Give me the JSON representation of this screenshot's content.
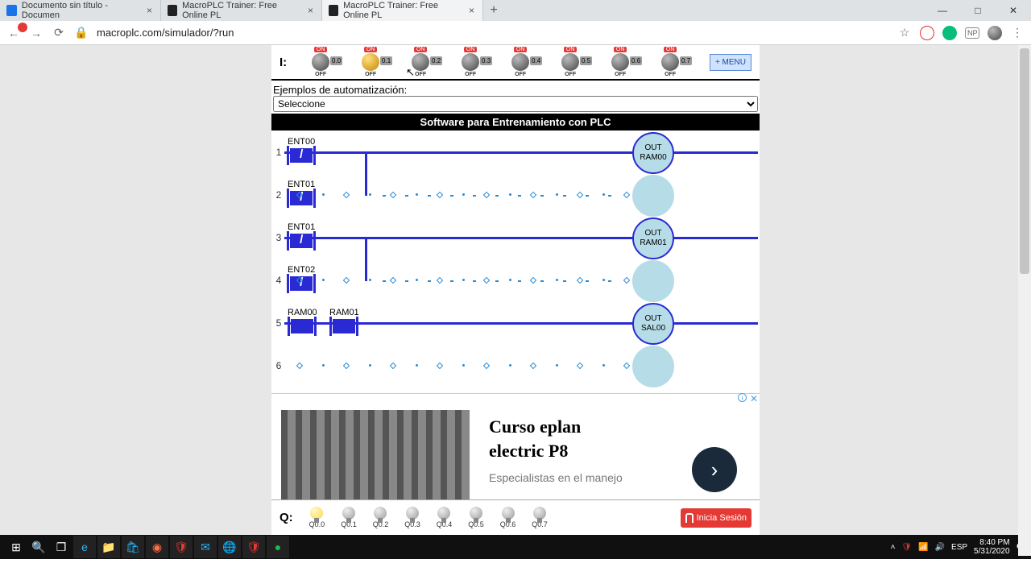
{
  "browser": {
    "tabs": [
      {
        "title": "Documento sin título - Documen",
        "kind": "doc"
      },
      {
        "title": "MacroPLC Trainer: Free Online PL",
        "kind": "mac"
      },
      {
        "title": "MacroPLC Trainer: Free Online PL",
        "kind": "mac",
        "active": true
      }
    ],
    "url": "macroplc.com/simulador/?run",
    "win_min": "—",
    "win_max": "□",
    "win_close": "✕",
    "ext_np": "NP"
  },
  "inputs": {
    "label": "I:",
    "list": [
      {
        "tag": "0.0"
      },
      {
        "tag": "0.1",
        "active": true
      },
      {
        "tag": "0.2"
      },
      {
        "tag": "0.3"
      },
      {
        "tag": "0.4"
      },
      {
        "tag": "0.5"
      },
      {
        "tag": "0.6"
      },
      {
        "tag": "0.7"
      }
    ],
    "on": "ON",
    "off": "OFF",
    "menu": "+ MENU"
  },
  "examples": {
    "label": "Ejemplos de automatización:",
    "selected": "Seleccione"
  },
  "banner": "Software para Entrenamiento con PLC",
  "rungs": [
    {
      "n": "1",
      "c1": {
        "name": "ENT00",
        "nc": true
      },
      "coil": {
        "top": "OUT",
        "bot": "RAM00"
      },
      "solid": true,
      "branchDown": true
    },
    {
      "n": "2",
      "c1": {
        "name": "ENT01",
        "nc": true
      },
      "dots": true,
      "coilBlank": true,
      "branchUp": true
    },
    {
      "n": "3",
      "c1": {
        "name": "ENT01",
        "nc": true
      },
      "coil": {
        "top": "OUT",
        "bot": "RAM01"
      },
      "solid": true,
      "branchDown": true
    },
    {
      "n": "4",
      "c1": {
        "name": "ENT02",
        "nc": true
      },
      "dots": true,
      "coilBlank": true,
      "branchUp": true
    },
    {
      "n": "5",
      "c1": {
        "name": "RAM00"
      },
      "c2": {
        "name": "RAM01"
      },
      "coil": {
        "top": "OUT",
        "bot": "SAL00"
      },
      "solid": true
    },
    {
      "n": "6",
      "dotsOnly": true,
      "coilBlank": true
    }
  ],
  "ad": {
    "title1": "Curso eplan",
    "title2": "electric P8",
    "sub": "Especialistas en el manejo",
    "arrow": "›",
    "close": "✕",
    "info": "i"
  },
  "outputs": {
    "label": "Q:",
    "list": [
      {
        "tag": "Q0.0",
        "on": true
      },
      {
        "tag": "Q0.1"
      },
      {
        "tag": "Q0.2"
      },
      {
        "tag": "Q0.3"
      },
      {
        "tag": "Q0.4"
      },
      {
        "tag": "Q0.5"
      },
      {
        "tag": "Q0.6"
      },
      {
        "tag": "Q0.7"
      }
    ],
    "login": "Inicia Sesión"
  },
  "tray": {
    "lang": "ESP",
    "time": "8:40 PM",
    "date": "5/31/2020"
  }
}
